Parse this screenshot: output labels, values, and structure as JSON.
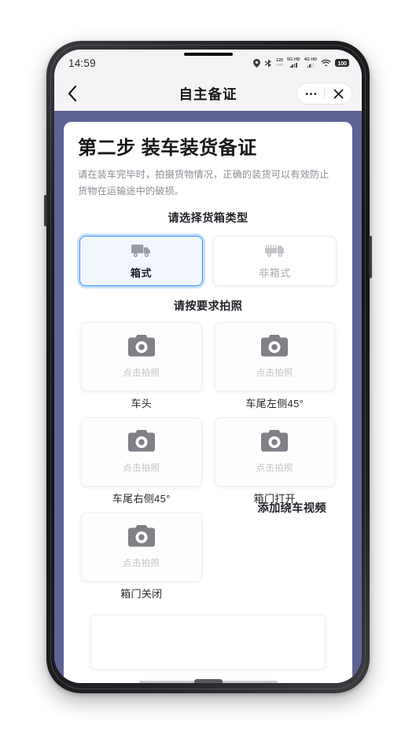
{
  "status_bar": {
    "time": "14:59",
    "icons": [
      {
        "name": "location-icon",
        "glyph": "location"
      },
      {
        "name": "bluetooth-icon",
        "glyph": "bluetooth"
      },
      {
        "name": "network-speed-icon",
        "top": "125",
        "bottom": "KB/s"
      },
      {
        "name": "sim1-signal-icon",
        "top": "5G HD",
        "bottom": "ull"
      },
      {
        "name": "sim2-signal-icon",
        "top": "4G HD",
        "bottom": "ull"
      },
      {
        "name": "wifi-icon",
        "glyph": "wifi"
      }
    ],
    "battery_level": "100"
  },
  "nav_bar": {
    "back_label": "‹",
    "title": "自主备证",
    "more_label": "•••",
    "close_label": "✕"
  },
  "page": {
    "step_title": "第二步 装车装货备证",
    "step_description": "请在装车完毕时，拍摄货物情况，正确的装货可以有效防止货物在运输途中的破损。",
    "container_type_heading": "请选择货箱类型",
    "container_types": [
      {
        "label": "箱式",
        "icon": "box-truck-icon",
        "selected": true
      },
      {
        "label": "非箱式",
        "icon": "flatbed-truck-icon",
        "selected": false
      }
    ],
    "photo_heading": "请按要求拍照",
    "photo_placeholder": "点击拍照",
    "photos": [
      {
        "caption": "车头",
        "placeholder": "点击拍照",
        "icon": "camera-icon"
      },
      {
        "caption": "车尾左侧45°",
        "placeholder": "点击拍照",
        "icon": "camera-icon"
      },
      {
        "caption": "车尾右侧45°",
        "placeholder": "点击拍照",
        "icon": "camera-icon"
      },
      {
        "caption": "箱门打开",
        "placeholder": "点击拍照",
        "icon": "camera-icon"
      },
      {
        "caption": "箱门关闭",
        "placeholder": "点击拍照",
        "icon": "camera-icon"
      }
    ],
    "video_heading": "添加绕车视频"
  },
  "colors": {
    "page_background": "#5e6394",
    "card_background": "#ffffff",
    "status_bar_background": "#f4f4f6",
    "accent_selected_border": "#3b8ff5",
    "accent_selected_fill": "#f2f7fe",
    "accent_selected_glow": "#7bb4f8",
    "title_text": "#17171a",
    "muted_text": "#8d8d96",
    "placeholder_text": "#c2c2c9",
    "icon_gray": "#808086"
  }
}
